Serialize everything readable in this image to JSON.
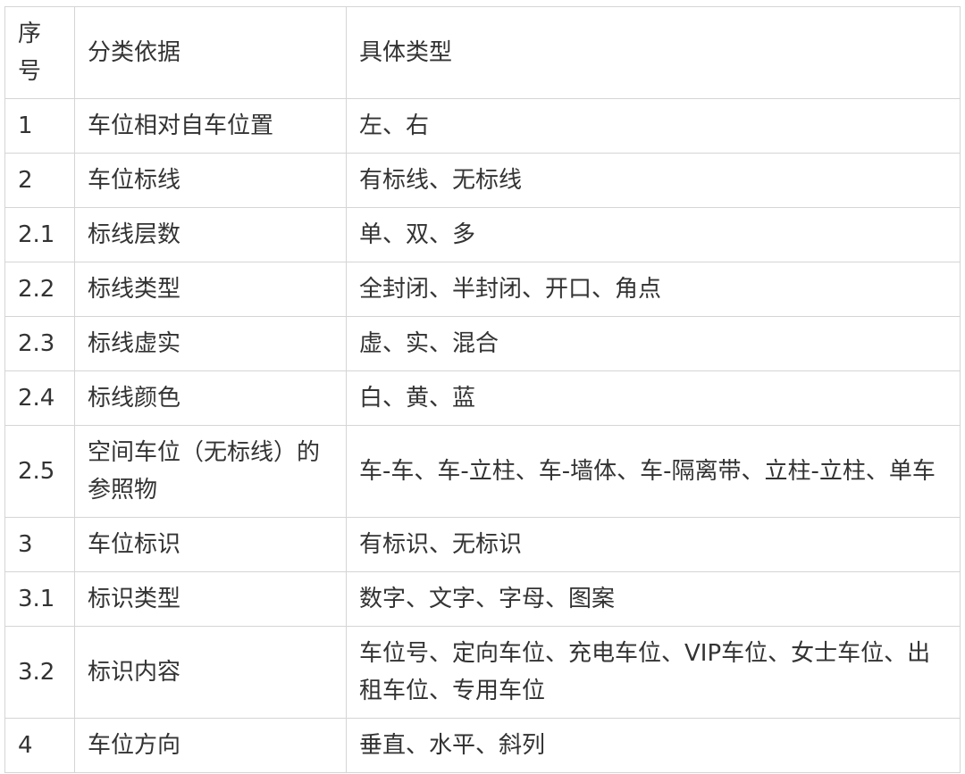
{
  "table": {
    "headers": [
      "序号",
      "分类依据",
      "具体类型"
    ],
    "rows": [
      {
        "id": "1",
        "basis": "车位相对自车位置",
        "types": "左、右"
      },
      {
        "id": "2",
        "basis": "车位标线",
        "types": "有标线、无标线"
      },
      {
        "id": "2.1",
        "basis": "标线层数",
        "types": "单、双、多"
      },
      {
        "id": "2.2",
        "basis": "标线类型",
        "types": "全封闭、半封闭、开口、角点"
      },
      {
        "id": "2.3",
        "basis": "标线虚实",
        "types": "虚、实、混合"
      },
      {
        "id": "2.4",
        "basis": "标线颜色",
        "types": "白、黄、蓝"
      },
      {
        "id": "2.5",
        "basis": "空间车位（无标线）的参照物",
        "types": "车-车、车-立柱、车-墙体、车-隔离带、立柱-立柱、单车"
      },
      {
        "id": "3",
        "basis": "车位标识",
        "types": "有标识、无标识"
      },
      {
        "id": "3.1",
        "basis": "标识类型",
        "types": "数字、文字、字母、图案"
      },
      {
        "id": "3.2",
        "basis": "标识内容",
        "types": "车位号、定向车位、充电车位、VIP车位、女士车位、出租车位、专用车位"
      },
      {
        "id": "4",
        "basis": "车位方向",
        "types": "垂直、水平、斜列"
      }
    ]
  }
}
